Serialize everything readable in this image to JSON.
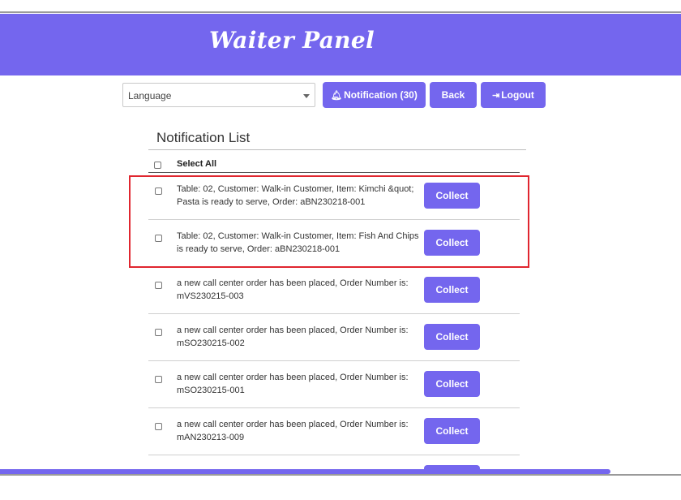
{
  "header": {
    "title": "Waiter Panel"
  },
  "toolbar": {
    "language_placeholder": "Language",
    "notification_label": "Notification (30)",
    "back_label": "Back",
    "logout_label": "Logout"
  },
  "list": {
    "title": "Notification List",
    "select_all_label": "Select All",
    "collect_label": "Collect",
    "items": [
      {
        "text": "Table: 02, Customer: Walk-in Customer, Item: Kimchi &quot; Pasta is ready to serve, Order: aBN230218-001"
      },
      {
        "text": "Table: 02, Customer: Walk-in Customer, Item: Fish And Chips is ready to serve, Order: aBN230218-001"
      },
      {
        "text": "a new call center order has been placed, Order Number is: mVS230215-003"
      },
      {
        "text": "a new call center order has been placed, Order Number is: mSO230215-002"
      },
      {
        "text": "a new call center order has been placed, Order Number is: mSO230215-001"
      },
      {
        "text": "a new call center order has been placed, Order Number is: mAN230213-009"
      }
    ]
  },
  "colors": {
    "accent": "#7466ee",
    "highlight": "#e0262f"
  },
  "icons": {
    "notification": "bell-icon",
    "logout": "sign-out-icon",
    "dropdown": "caret-down-icon"
  }
}
